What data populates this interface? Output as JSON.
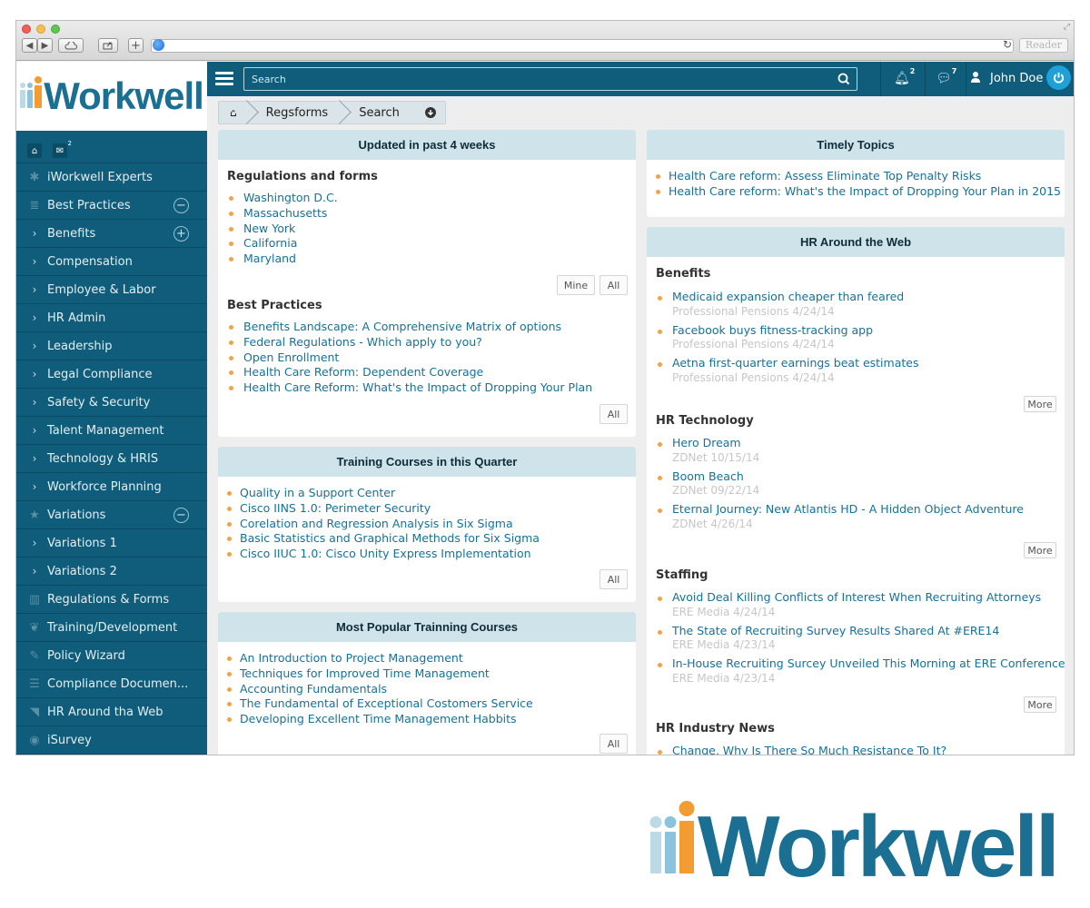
{
  "browser": {
    "reader_label": "Reader",
    "reload_icon": "reload-icon",
    "colors": {
      "red": "#ee5f57",
      "yellow": "#f5bf4f",
      "green": "#61c454"
    }
  },
  "brand": {
    "name": "Workwell",
    "colors": {
      "dark_blue": "#1a6f93",
      "light_blue": "#3fa3cd",
      "orange": "#f29c31",
      "sidebar": "#0f5d7a"
    }
  },
  "sidebar": {
    "home_badge": "",
    "messages_badge": "2",
    "items": [
      {
        "label": "iWorkwell Experts",
        "icon": "asterisk-icon"
      },
      {
        "label": "Best Practices",
        "icon": "list-icon",
        "toggle": "−"
      },
      {
        "label": "Benefits",
        "icon": "chevron-right-icon",
        "toggle": "+"
      },
      {
        "label": "Compensation",
        "icon": "chevron-right-icon"
      },
      {
        "label": "Employee & Labor",
        "icon": "chevron-right-icon"
      },
      {
        "label": "HR Admin",
        "icon": "chevron-right-icon"
      },
      {
        "label": "Leadership",
        "icon": "chevron-right-icon"
      },
      {
        "label": "Legal Compliance",
        "icon": "chevron-right-icon"
      },
      {
        "label": "Safety & Security",
        "icon": "chevron-right-icon"
      },
      {
        "label": "Talent Management",
        "icon": "chevron-right-icon"
      },
      {
        "label": "Technology & HRIS",
        "icon": "chevron-right-icon"
      },
      {
        "label": "Workforce Planning",
        "icon": "chevron-right-icon"
      },
      {
        "label": "Variations",
        "icon": "star-icon",
        "toggle": "−"
      },
      {
        "label": "Variations 1",
        "icon": "chevron-right-icon"
      },
      {
        "label": "Variations 2",
        "icon": "chevron-right-icon"
      },
      {
        "label": "Regulations & Forms",
        "icon": "bar-chart-icon"
      },
      {
        "label": "Training/Development",
        "icon": "leaf-icon"
      },
      {
        "label": "Policy Wizard",
        "icon": "edit-icon"
      },
      {
        "label": "Compliance Documen...",
        "icon": "document-icon"
      },
      {
        "label": "HR Around tha Web",
        "icon": "rss-icon"
      },
      {
        "label": "iSurvey",
        "icon": "eye-icon"
      }
    ]
  },
  "topbar": {
    "search_placeholder": "Search",
    "notifications_count": "2",
    "messages_count": "7",
    "user_name": "John Doe"
  },
  "breadcrumb": {
    "items": [
      "Regsforms",
      "Search"
    ]
  },
  "updated_panel": {
    "title": "Updated in past 4 weeks",
    "regs_title": "Regulations and forms",
    "regs": [
      "Washington D.C.",
      "Massachusetts",
      "New York",
      "California",
      "Maryland"
    ],
    "mine_label": "Mine",
    "all_label": "All",
    "bp_title": "Best Practices",
    "bp": [
      "Benefits Landscape: A Comprehensive Matrix of options",
      "Federal Regulations - Which apply to you?",
      "Open Enrollment",
      "Health Care Reform: Dependent Coverage",
      "Health Care Reform: What's the Impact of Dropping Your Plan"
    ],
    "all2_label": "All"
  },
  "training_panel": {
    "title": "Training Courses in this Quarter",
    "items": [
      "Quality in a Support Center",
      "Cisco IINS 1.0: Perimeter Security",
      "Corelation and Regression Analysis in Six Sigma",
      "Basic Statistics and Graphical Methods for Six Sigma",
      "Cisco IIUC 1.0: Cisco Unity Express Implementation"
    ],
    "all_label": "All"
  },
  "popular_panel": {
    "title": "Most Popular Trainning Courses",
    "items": [
      "An Introduction to Project Management",
      "Techniques for Improved Time Management",
      "Accounting Fundamentals",
      "The Fundamental of Exceptional Costomers Service",
      "Developing Excellent Time Management Habbits"
    ],
    "all_label": "All"
  },
  "timely_panel": {
    "title": "Timely Topics",
    "items": [
      "Health Care reform: Assess   Eliminate Top Penalty Risks",
      "Health Care reform: What's the Impact of Dropping Your Plan in 2015"
    ]
  },
  "web_panel": {
    "title": "HR Around the Web",
    "more_label": "More",
    "benefits_title": "Benefits",
    "benefits": [
      {
        "title": "Medicaid expansion cheaper than feared",
        "meta": "Professional Pensions 4/24/14"
      },
      {
        "title": "Facebook buys fitness-tracking app",
        "meta": "Professional Pensions 4/24/14"
      },
      {
        "title": "Aetna first-quarter earnings beat estimates",
        "meta": "Professional Pensions 4/24/14"
      }
    ],
    "tech_title": "HR Technology",
    "tech": [
      {
        "title": "Hero Dream",
        "meta": "ZDNet 10/15/14"
      },
      {
        "title": "Boom Beach",
        "meta": "ZDNet 09/22/14"
      },
      {
        "title": "Eternal Journey: New Atlantis HD - A Hidden Object Adventure",
        "meta": "ZDNet 4/26/14"
      }
    ],
    "staffing_title": "Staffing",
    "staffing": [
      {
        "title": "Avoid Deal Killing Conflicts of Interest When Recruiting Attorneys",
        "meta": "ERE Media 4/24/14"
      },
      {
        "title": "The State of Recruiting Survey Results Shared At #ERE14",
        "meta": "ERE Media 4/23/14"
      },
      {
        "title": "In-House Recruiting Surcey Unveiled This Morning at ERE Conference",
        "meta": "ERE Media 4/23/14"
      }
    ],
    "industry_title": "HR Industry News",
    "industry": [
      {
        "title": "Change, Why Is There So Much Resistance To It?"
      }
    ]
  }
}
